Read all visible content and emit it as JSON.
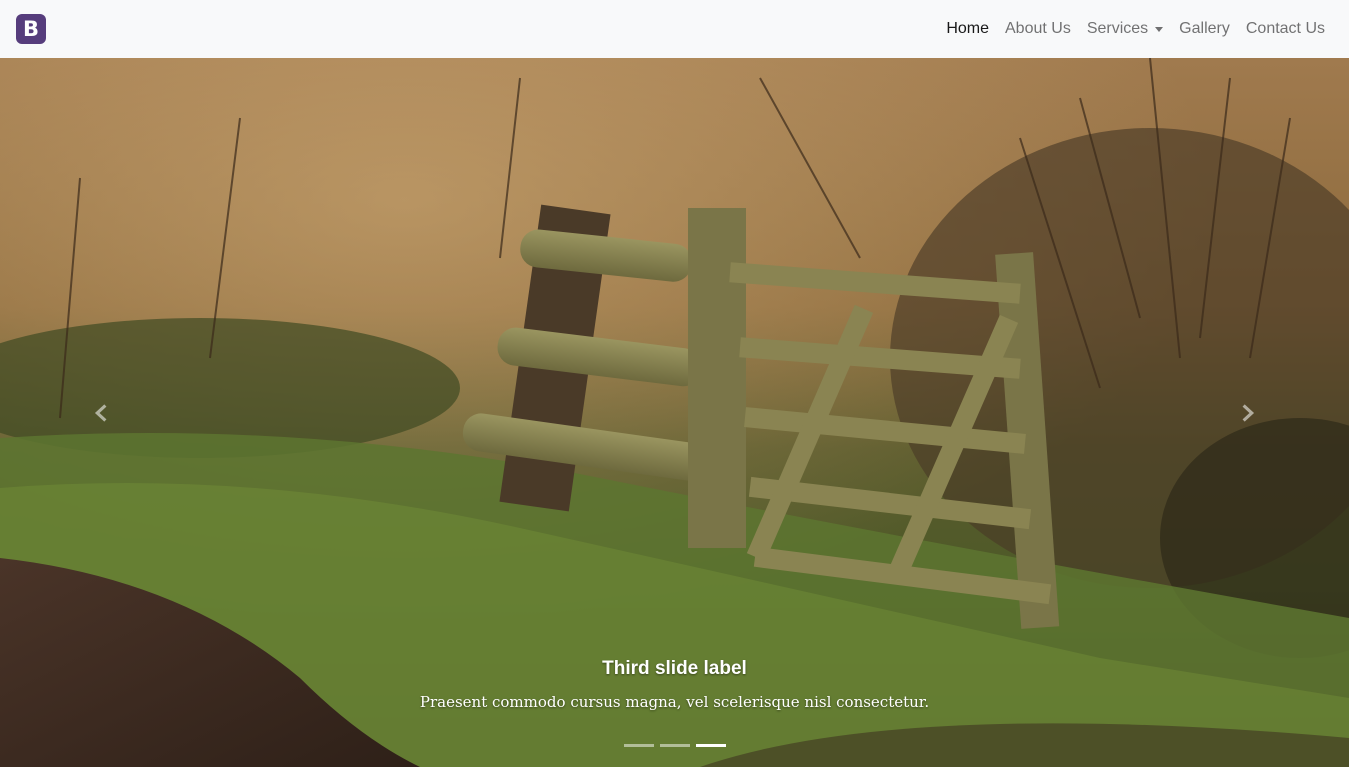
{
  "navbar": {
    "brand_letter": "B",
    "brand_color": "#563d7c",
    "links": [
      {
        "label": "Home",
        "active": true
      },
      {
        "label": "About Us"
      },
      {
        "label": "Services",
        "dropdown": true
      },
      {
        "label": "Gallery"
      },
      {
        "label": "Contact Us"
      }
    ]
  },
  "carousel": {
    "active_slide": 3,
    "slide_count": 3,
    "caption": {
      "title": "Third slide label",
      "text": "Praesent commodo cursus magna, vel scelerisque nisl consectetur."
    },
    "prev_icon": "chevron-left-icon",
    "next_icon": "chevron-right-icon"
  }
}
